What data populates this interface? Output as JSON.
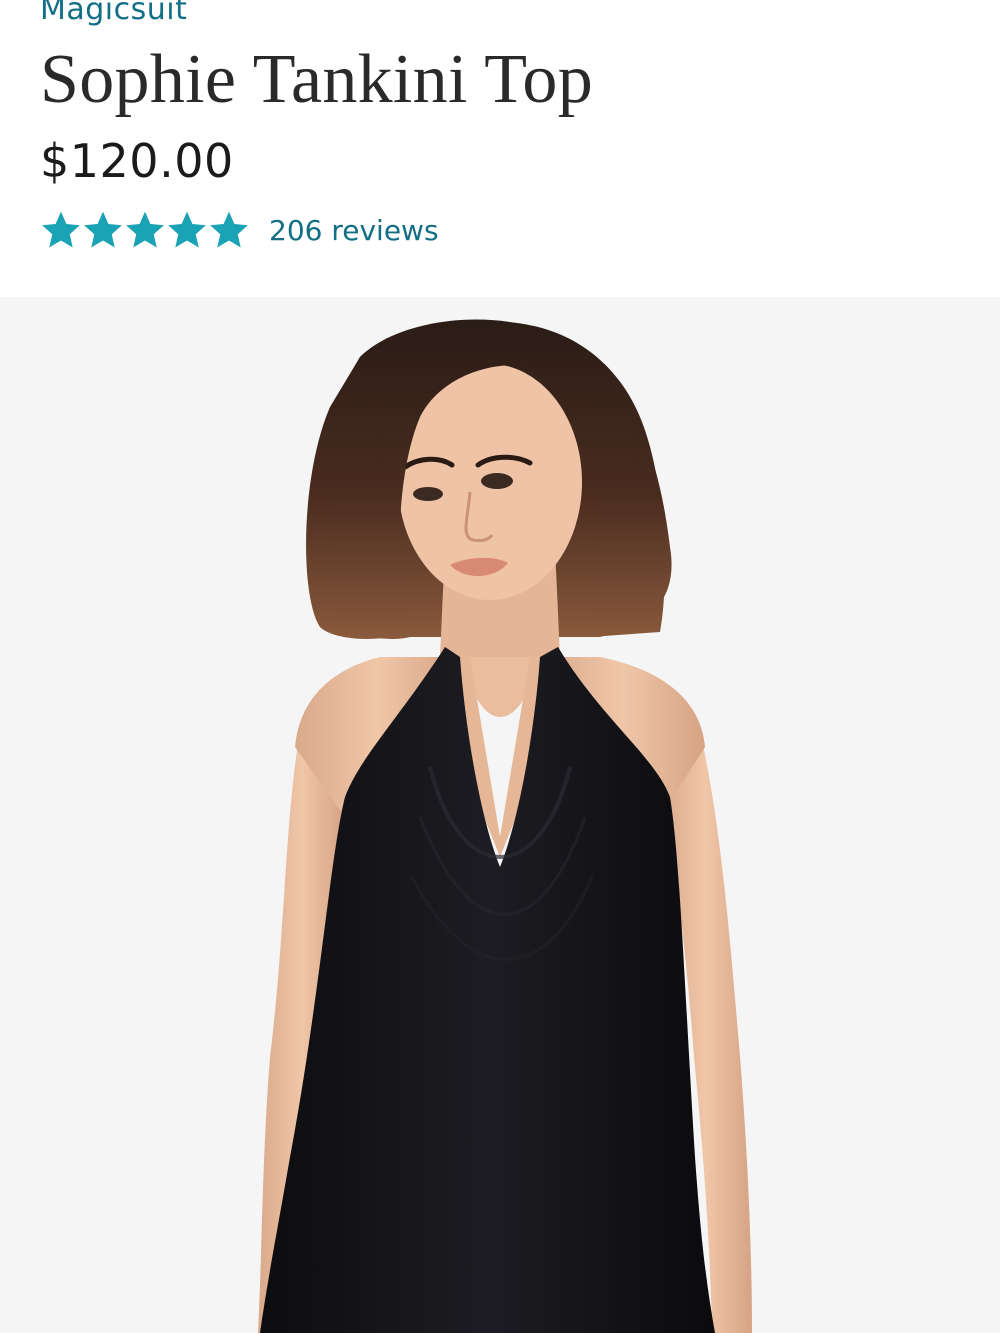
{
  "brand": "Magicsuit",
  "product": {
    "title": "Sophie Tankini Top",
    "price": "$120.00",
    "rating": {
      "stars": 5,
      "max": 5,
      "reviews_label": "206 reviews"
    }
  },
  "colors": {
    "accent": "#136f86",
    "star": "#1aa3b4",
    "title": "#2a2a2a",
    "photo_bg": "#f5f5f5"
  },
  "image": {
    "alt": "Model wearing black halter cowl-neck tankini top"
  }
}
